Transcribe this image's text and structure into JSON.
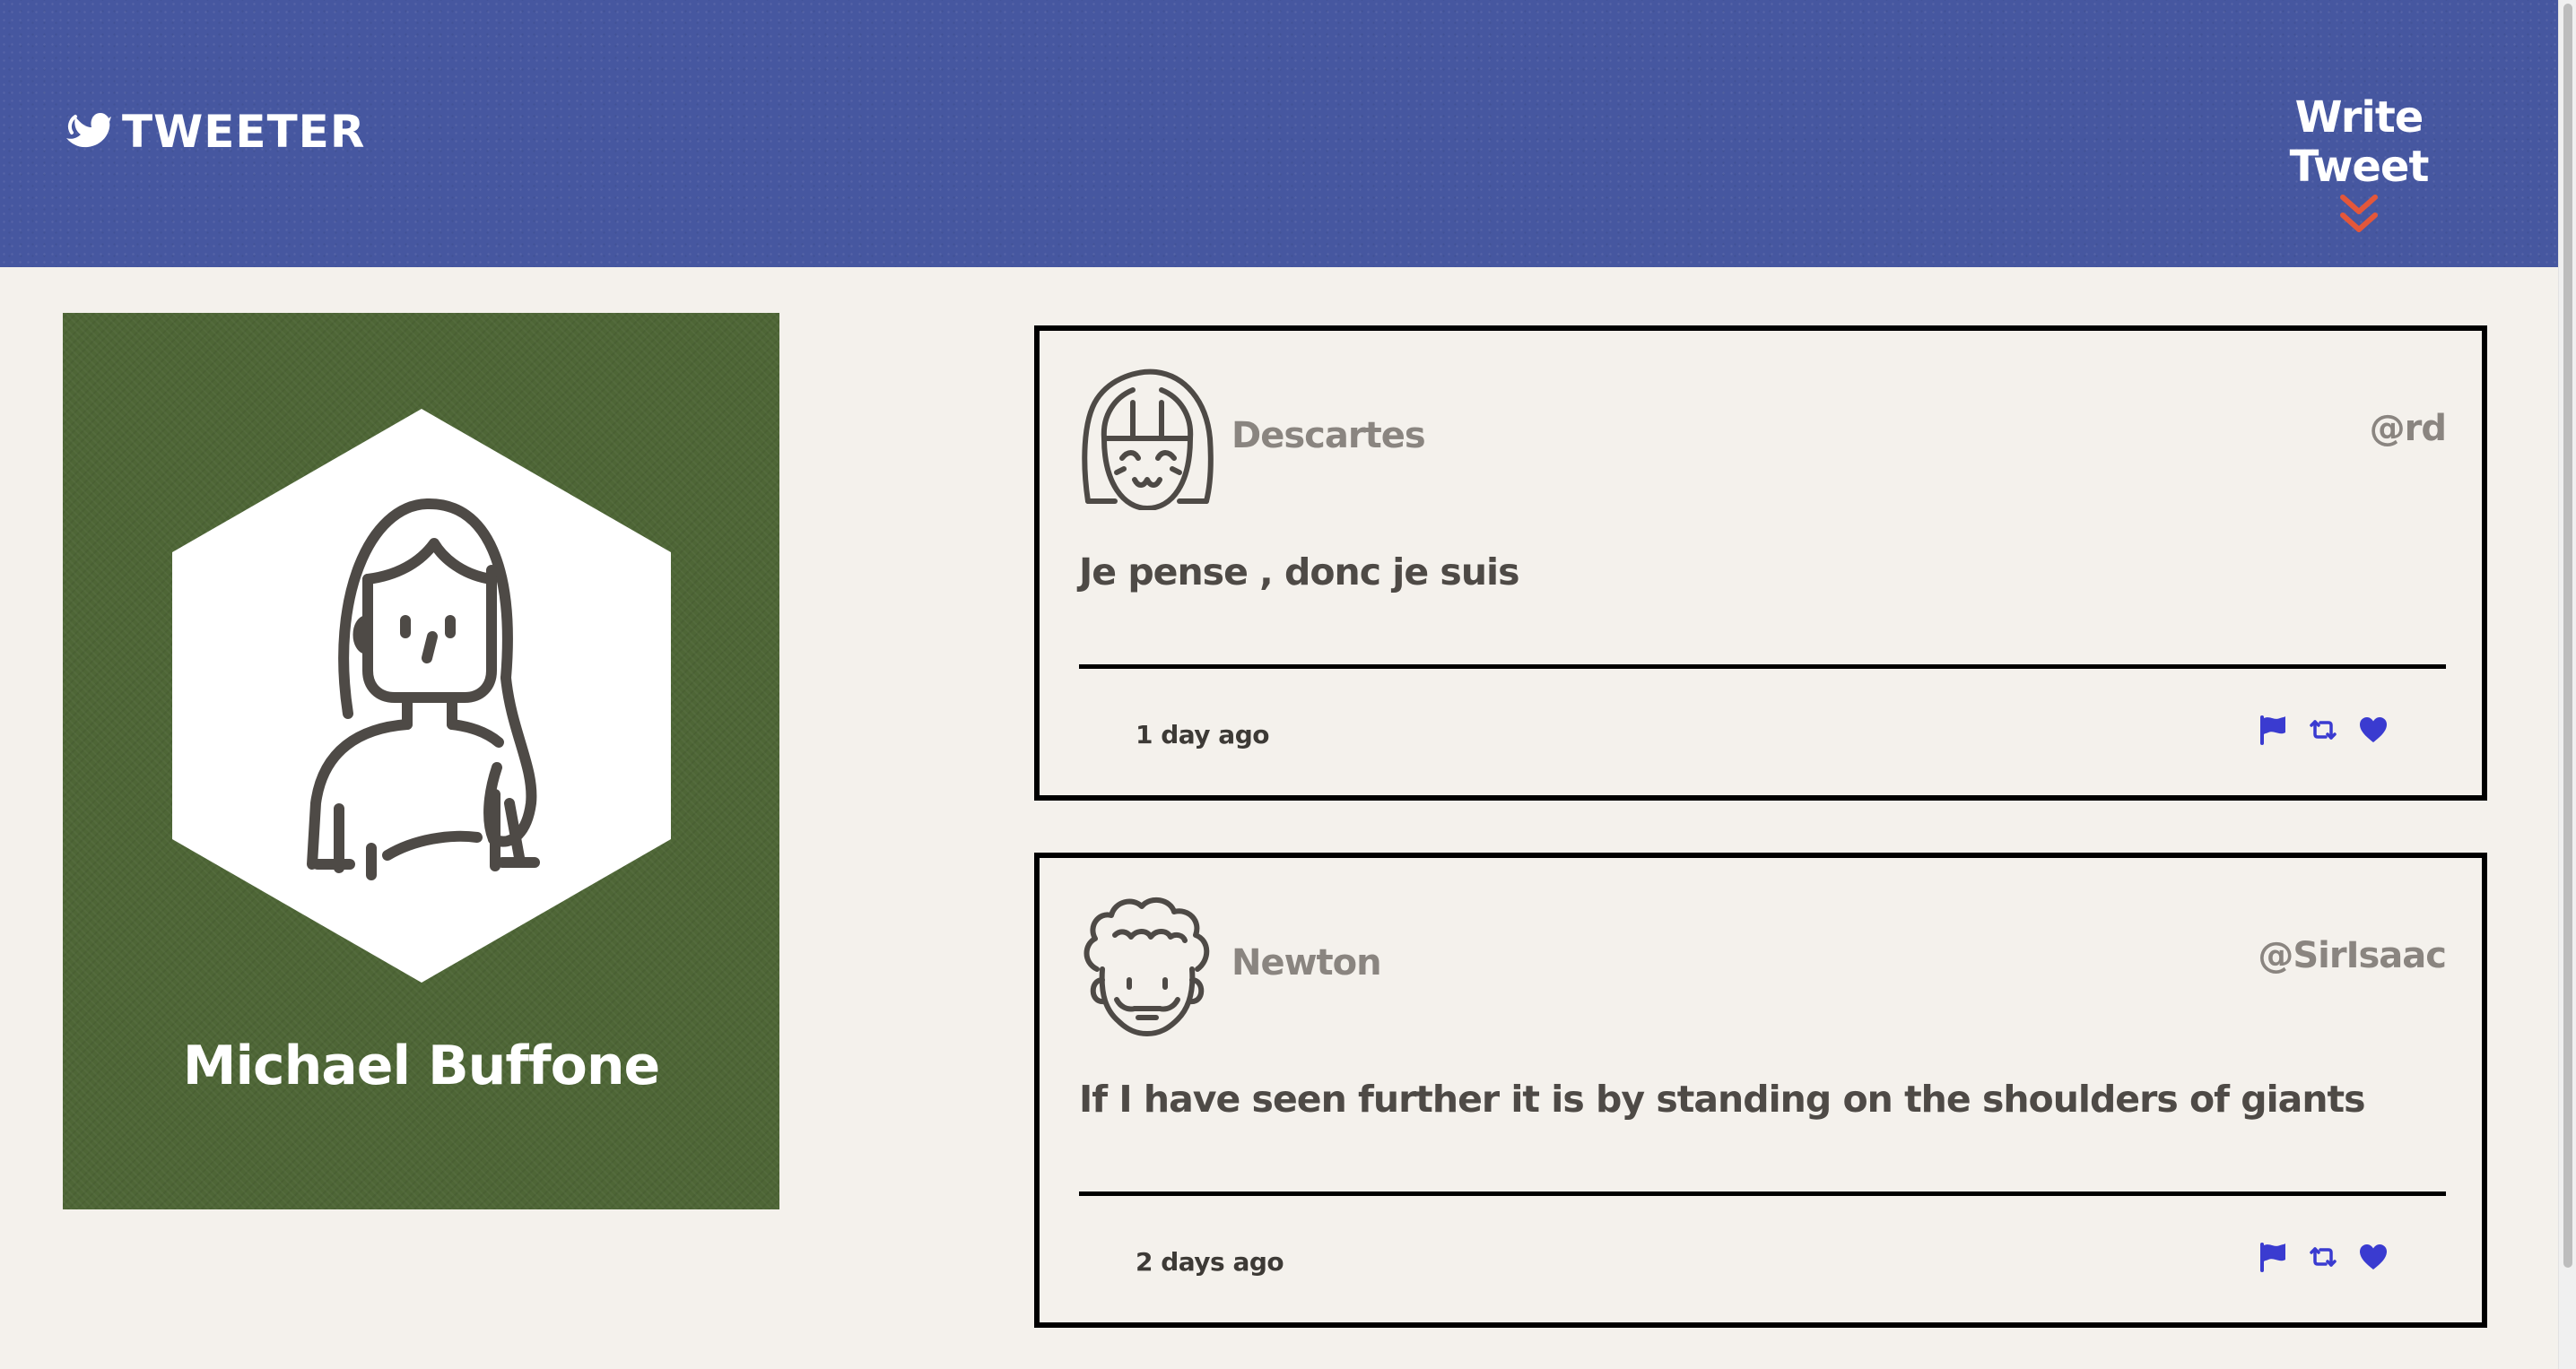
{
  "nav": {
    "brand_label": "TWEETER",
    "brand_icon": "dove-icon",
    "write_tweet_label": "Write Tweet",
    "write_tweet_icon": "double-chevron-down-icon"
  },
  "colors": {
    "nav_bg": "#4657a0",
    "profile_bg": "#4e6636",
    "chevron": "#e4573a",
    "action_icons": "#3a3bd0",
    "page_bg": "#f4f1ec"
  },
  "profile": {
    "name": "Michael Buffone",
    "avatar_icon": "woman-avatar-icon"
  },
  "tweets": [
    {
      "name": "Descartes",
      "handle": "@rd",
      "text": "Je pense , donc je suis",
      "time": "1 day ago",
      "avatar_icon": "girl-avatar-icon",
      "actions": [
        "flag-icon",
        "retweet-icon",
        "heart-icon"
      ]
    },
    {
      "name": "Newton",
      "handle": "@SirIsaac",
      "text": "If I have seen further it is by standing on the shoulders of giants",
      "time": "2 days ago",
      "avatar_icon": "curly-man-avatar-icon",
      "actions": [
        "flag-icon",
        "retweet-icon",
        "heart-icon"
      ]
    }
  ]
}
